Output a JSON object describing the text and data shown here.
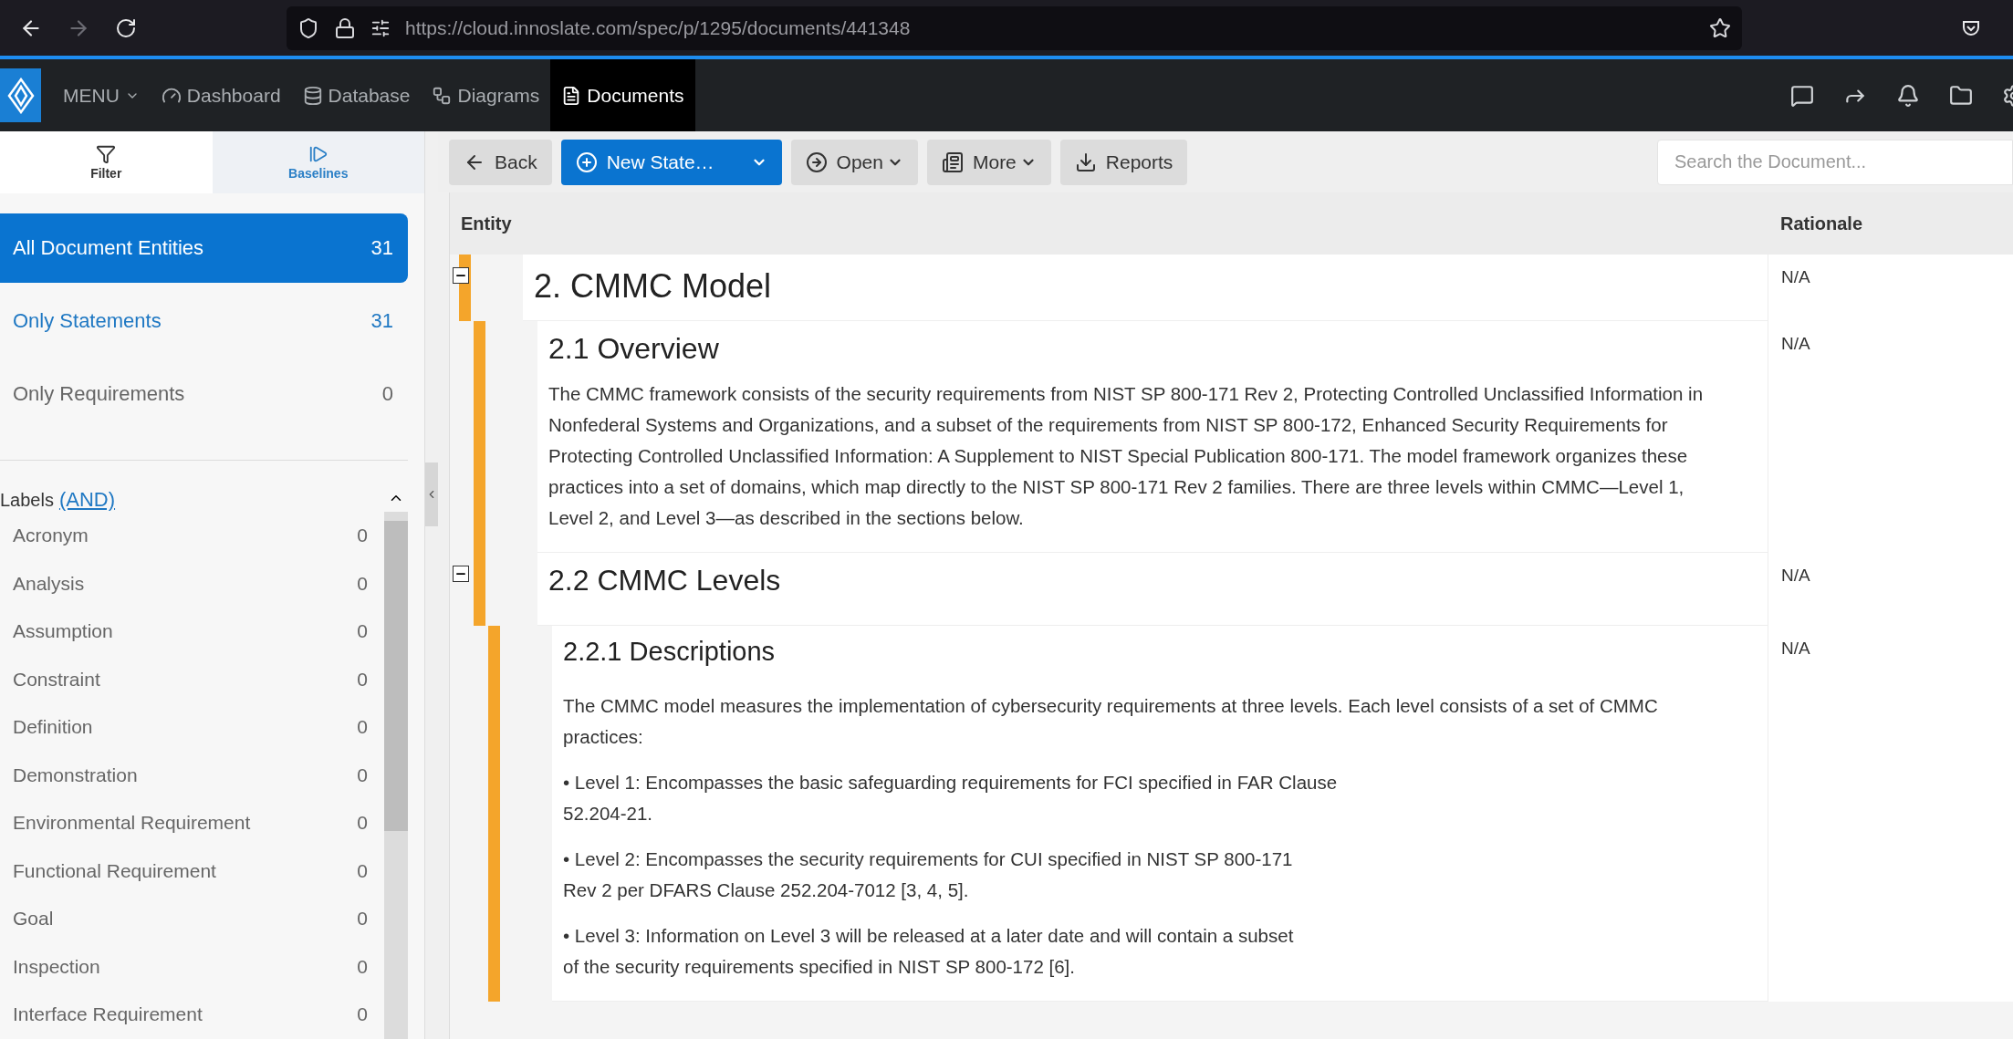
{
  "browser": {
    "url": "https://cloud.innoslate.com/spec/p/1295/documents/441348"
  },
  "nav": {
    "menu": "MENU",
    "items": [
      {
        "label": "Dashboard",
        "selected": false
      },
      {
        "label": "Database",
        "selected": false
      },
      {
        "label": "Diagrams",
        "selected": false
      },
      {
        "label": "Documents",
        "selected": true
      }
    ]
  },
  "sidebar": {
    "tabs": [
      {
        "label": "Filter",
        "selected": true
      },
      {
        "label": "Baselines",
        "selected": false
      }
    ],
    "filters": [
      {
        "label": "All Document Entities",
        "count": "31",
        "selected": true,
        "highlighted": true
      },
      {
        "label": "Only Statements",
        "count": "31",
        "selected": false,
        "highlighted": true
      },
      {
        "label": "Only Requirements",
        "count": "0",
        "selected": false,
        "highlighted": false
      }
    ],
    "labels_title": "Labels",
    "labels_operator": "(AND)",
    "labels": [
      {
        "label": "Acronym",
        "count": "0"
      },
      {
        "label": "Analysis",
        "count": "0"
      },
      {
        "label": "Assumption",
        "count": "0"
      },
      {
        "label": "Constraint",
        "count": "0"
      },
      {
        "label": "Definition",
        "count": "0"
      },
      {
        "label": "Demonstration",
        "count": "0"
      },
      {
        "label": "Environmental Requirement",
        "count": "0"
      },
      {
        "label": "Functional Requirement",
        "count": "0"
      },
      {
        "label": "Goal",
        "count": "0"
      },
      {
        "label": "Inspection",
        "count": "0"
      },
      {
        "label": "Interface Requirement",
        "count": "0"
      }
    ]
  },
  "toolbar": {
    "buttons": [
      {
        "label": "Back",
        "kind": "default",
        "has_menu": false
      },
      {
        "label": "New State…",
        "kind": "primary",
        "has_menu": true
      },
      {
        "label": "Open",
        "kind": "default",
        "has_menu": true
      },
      {
        "label": "More",
        "kind": "default",
        "has_menu": true
      },
      {
        "label": "Reports",
        "kind": "default",
        "has_menu": false
      }
    ],
    "search": {
      "placeholder": "Search the Document..."
    }
  },
  "table": {
    "columns": [
      "Entity",
      "Rationale"
    ],
    "entities": [
      {
        "title": "2. CMMC Model",
        "rationale": "N/A",
        "expanded": true,
        "children": [
          {
            "title": "2.1 Overview",
            "rationale": "N/A",
            "body": [
              "The CMMC framework consists of the security requirements from NIST SP 800-171 Rev 2, Protecting Controlled Unclassified Information in Nonfederal Systems and Organizations, and a subset of the requirements from NIST SP 800-172, Enhanced Security Requirements for Protecting Controlled Unclassified Information: A Supplement to NIST Special Publication 800-171. The model framework organizes these practices into a set of domains, which map directly to the NIST SP 800-171 Rev 2 families. There are three levels within CMMC—Level 1, Level 2, and Level 3—as described in the sections below."
            ]
          },
          {
            "title": "2.2 CMMC Levels",
            "rationale": "N/A",
            "expanded": true,
            "children": [
              {
                "title": "2.2.1 Descriptions",
                "rationale": "N/A",
                "body": [
                  "The CMMC model measures the implementation of cybersecurity requirements at three levels. Each level consists of a set of CMMC practices:",
                  "• Level 1: Encompasses the basic safeguarding requirements for FCI specified in FAR Clause\n52.204-21.",
                  "• Level 2: Encompasses the security requirements for CUI specified in NIST SP 800-171\nRev 2 per DFARS Clause 252.204-7012 [3, 4, 5].",
                  "• Level 3: Information on Level 3 will be released at a later date and will contain a subset\nof the security requirements specified in NIST SP 800-172 [6]."
                ]
              }
            ]
          }
        ]
      }
    ]
  }
}
